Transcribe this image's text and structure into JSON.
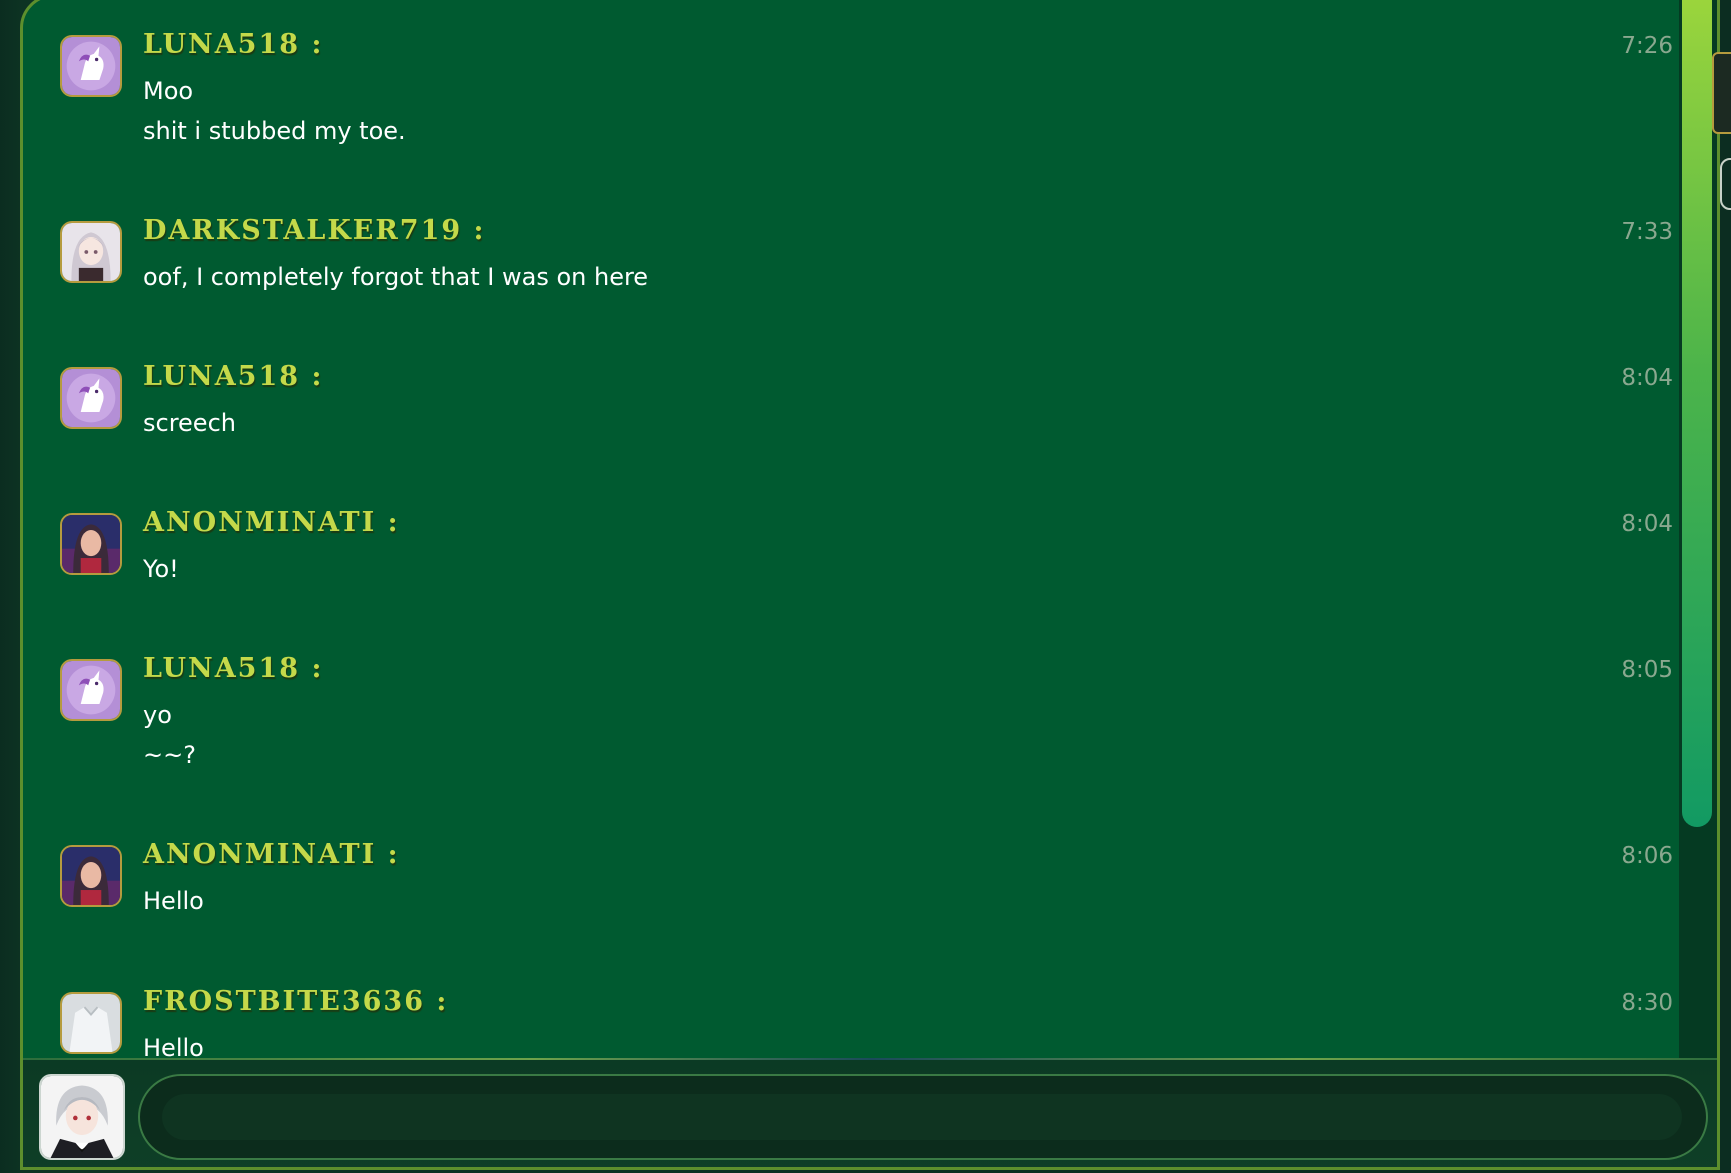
{
  "messages": [
    {
      "user": "LUNA518 :",
      "time": "7:26",
      "avatar": "unicorn-avatar",
      "lines": [
        "Moo",
        "shit i stubbed my toe."
      ]
    },
    {
      "user": "DARKSTALKER719 :",
      "time": "7:33",
      "avatar": "anime-girl-avatar",
      "lines": [
        "oof, I completely forgot that I was on here"
      ]
    },
    {
      "user": "LUNA518 :",
      "time": "8:04",
      "avatar": "unicorn-avatar",
      "lines": [
        "screech"
      ]
    },
    {
      "user": "ANONMINATI :",
      "time": "8:04",
      "avatar": "woman-portrait-avatar",
      "lines": [
        "Yo!"
      ]
    },
    {
      "user": "LUNA518 :",
      "time": "8:05",
      "avatar": "unicorn-avatar",
      "lines": [
        "yo",
        "~~?"
      ]
    },
    {
      "user": "ANONMINATI :",
      "time": "8:06",
      "avatar": "woman-portrait-avatar",
      "lines": [
        "Hello"
      ]
    },
    {
      "user": "FROSTBITE3636 :",
      "time": "8:30",
      "avatar": "white-shirt-avatar",
      "lines": [
        "Hello"
      ]
    }
  ],
  "composer": {
    "placeholder": "",
    "value": "",
    "my_avatar": "anime-boy-avatar"
  },
  "colors": {
    "chat_background": "#005a30",
    "username": "#c4d94a",
    "timestamp": "#8aa88f",
    "message_text": "#ffffff",
    "avatar_border": "#b59b3e",
    "scroll_thumb_top": "#9bd53c",
    "scroll_thumb_bottom": "#129a63"
  }
}
